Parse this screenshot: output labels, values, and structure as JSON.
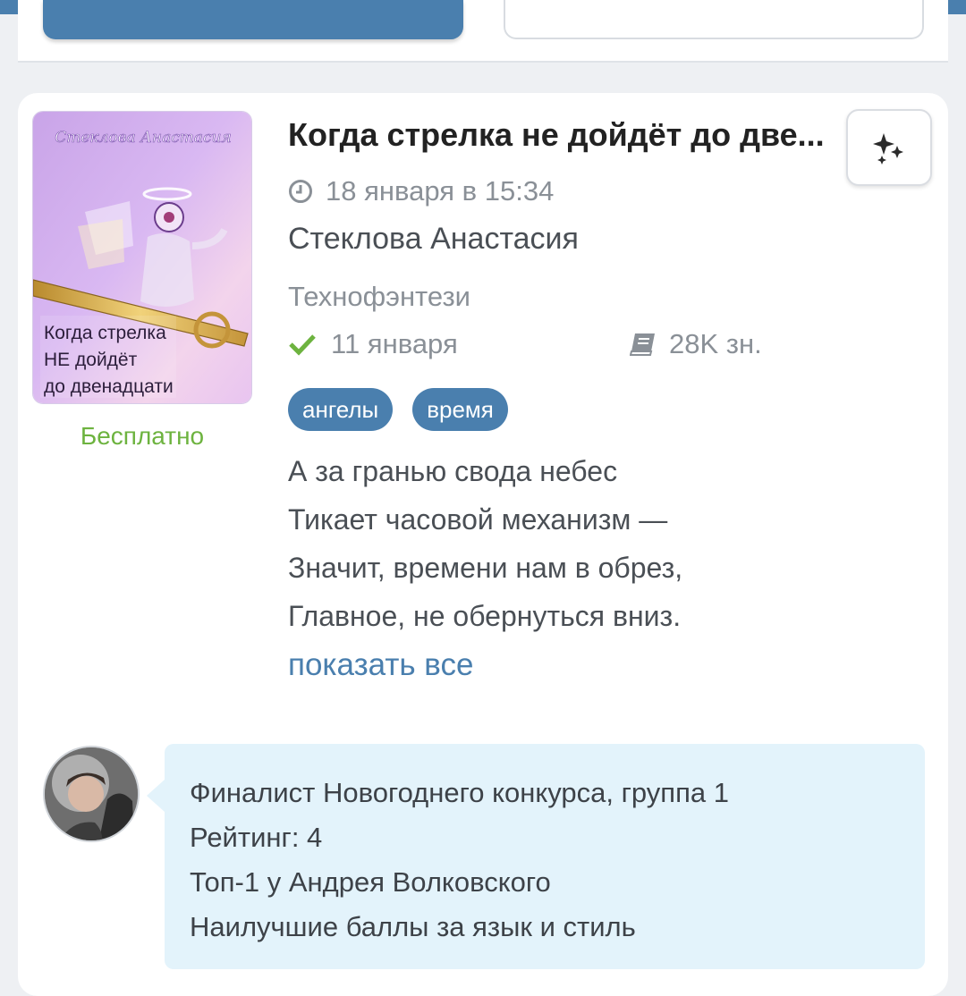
{
  "colors": {
    "accent": "#4a7fae",
    "price_green": "#6db33f",
    "check_green": "#6db33f",
    "bubble_bg": "#e3f3fb"
  },
  "book": {
    "title": "Когда стрелка не дойдёт до две...",
    "date": "18 января в 15:34",
    "author": "Стеклова Анастасия",
    "genre": "Технофэнтези",
    "updated": "11 января",
    "size": "28K зн.",
    "price": "Бесплатно",
    "tags": [
      "ангелы",
      "время"
    ],
    "excerpt": [
      "А за гранью свода небес",
      "Тикает часовой механизм —",
      "Значит, времени нам в обрез,",
      "Главное, не обернуться вниз."
    ],
    "show_all": "показать все",
    "cover": {
      "author_text": "Стеклова Анастасия",
      "title_lines": [
        "Когда стрелка",
        "НЕ дойдёт",
        "до двенадцати"
      ]
    }
  },
  "icons": {
    "clock": "clock-icon",
    "check": "check-icon",
    "book": "book-icon",
    "sparkles": "sparkles-icon"
  },
  "review": {
    "lines": [
      "Финалист Новогоднего конкурса, группа 1",
      "Рейтинг: 4",
      "Топ-1 у Андрея Волковского",
      "Наилучшие баллы за язык и стиль"
    ]
  }
}
